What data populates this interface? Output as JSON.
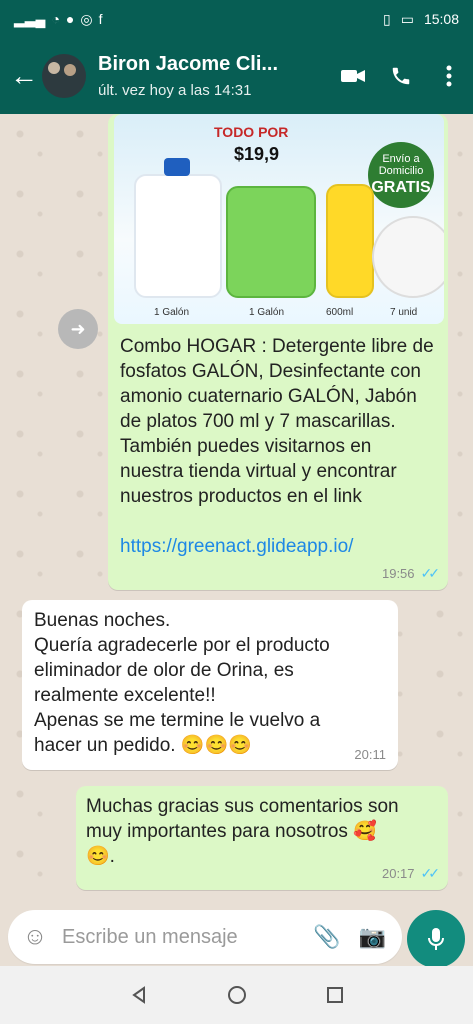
{
  "statusbar": {
    "time": "15:08"
  },
  "header": {
    "contact_name": "Biron Jacome Cli...",
    "last_seen": "últ. vez hoy a las 14:31"
  },
  "messages": [
    {
      "direction": "outgoing",
      "image": {
        "top_text": "TODO POR",
        "price": "$19,9",
        "badge_line1": "Envío a Domicilio",
        "badge_line2": "GRATIS",
        "labels": [
          "1 Galón",
          "1 Galón",
          "600ml",
          "7 unid"
        ]
      },
      "text": "Combo HOGAR : Detergente libre de fosfatos GALÓN, Desinfectante con amonio cuaternario GALÓN, Jabón de platos 700 ml y 7 mascarillas.     También puedes visitarnos en nuestra tienda virtual y encontrar nuestros productos en el link",
      "link": "https://greenact.glideapp.io/",
      "time": "19:56"
    },
    {
      "direction": "incoming",
      "text": "Buenas noches.\nQuería agradecerle por el producto eliminador de olor de Orina, es realmente excelente!!\nApenas se me termine le vuelvo a hacer un pedido. 😊😊😊",
      "time": "20:11"
    },
    {
      "direction": "outgoing",
      "text": "Muchas gracias sus comentarios son muy importantes para nosotros 🥰\n😊.",
      "time": "20:17"
    }
  ],
  "composer": {
    "placeholder": "Escribe un mensaje"
  },
  "colors": {
    "header": "#075e54",
    "outgoing_bubble": "#dcf8c6",
    "incoming_bubble": "#ffffff",
    "chat_bg": "#e8dfd5",
    "mic": "#128c7e"
  },
  "icons": {
    "back": "back-arrow-icon",
    "video": "video-call-icon",
    "call": "phone-icon",
    "menu": "more-vert-icon",
    "forward": "forward-icon",
    "emoji": "emoji-icon",
    "attach": "paperclip-icon",
    "camera": "camera-icon",
    "mic": "microphone-icon"
  }
}
